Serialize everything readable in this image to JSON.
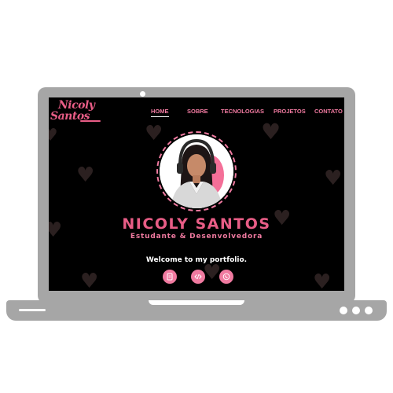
{
  "logo": {
    "line1": "Nicoly",
    "line2": "Santos"
  },
  "nav": {
    "items": [
      {
        "label": "HOME",
        "active": true
      },
      {
        "label": "SOBRE",
        "active": false
      },
      {
        "label": "TECNOLOGIAS",
        "active": false
      },
      {
        "label": "PROJETOS",
        "active": false
      },
      {
        "label": "CONTATO",
        "active": false
      }
    ]
  },
  "hero": {
    "name": "NICOLY SANTOS",
    "role": "Estudante & Desenvolvedora",
    "welcome": "Welcome to my portfolio."
  },
  "social": [
    {
      "icon": "document-icon"
    },
    {
      "icon": "code-icon"
    },
    {
      "icon": "phone-icon"
    }
  ],
  "colors": {
    "accent": "#e85d86",
    "accent_light": "#f07aa0",
    "screen_bg": "#000000",
    "laptop": "#a6a6a6",
    "heart": "#2b2020"
  }
}
